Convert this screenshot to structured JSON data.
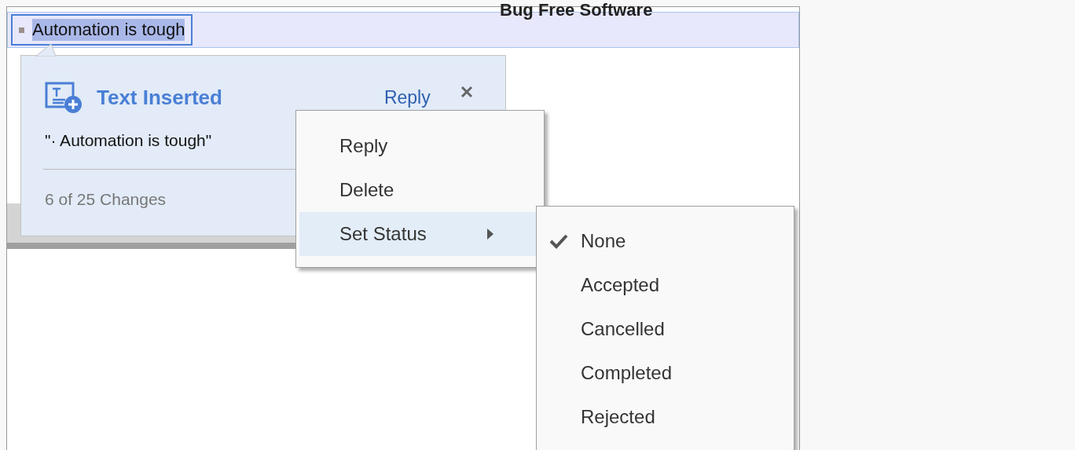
{
  "document": {
    "heading": "Bug Free Software",
    "selected_text": "Automation is tough"
  },
  "change_popup": {
    "title": "Text Inserted",
    "reply_link": "Reply",
    "quote": "\"· Automation is tough\"",
    "counter": "6 of 25 Changes"
  },
  "context_menu": {
    "items": [
      {
        "label": "Reply",
        "selected": false,
        "submenu": false
      },
      {
        "label": "Delete",
        "selected": false,
        "submenu": false
      },
      {
        "label": "Set Status",
        "selected": true,
        "submenu": true
      }
    ]
  },
  "status_submenu": {
    "items": [
      {
        "label": "None",
        "checked": true
      },
      {
        "label": "Accepted",
        "checked": false
      },
      {
        "label": "Cancelled",
        "checked": false
      },
      {
        "label": "Completed",
        "checked": false
      },
      {
        "label": "Rejected",
        "checked": false
      }
    ]
  }
}
